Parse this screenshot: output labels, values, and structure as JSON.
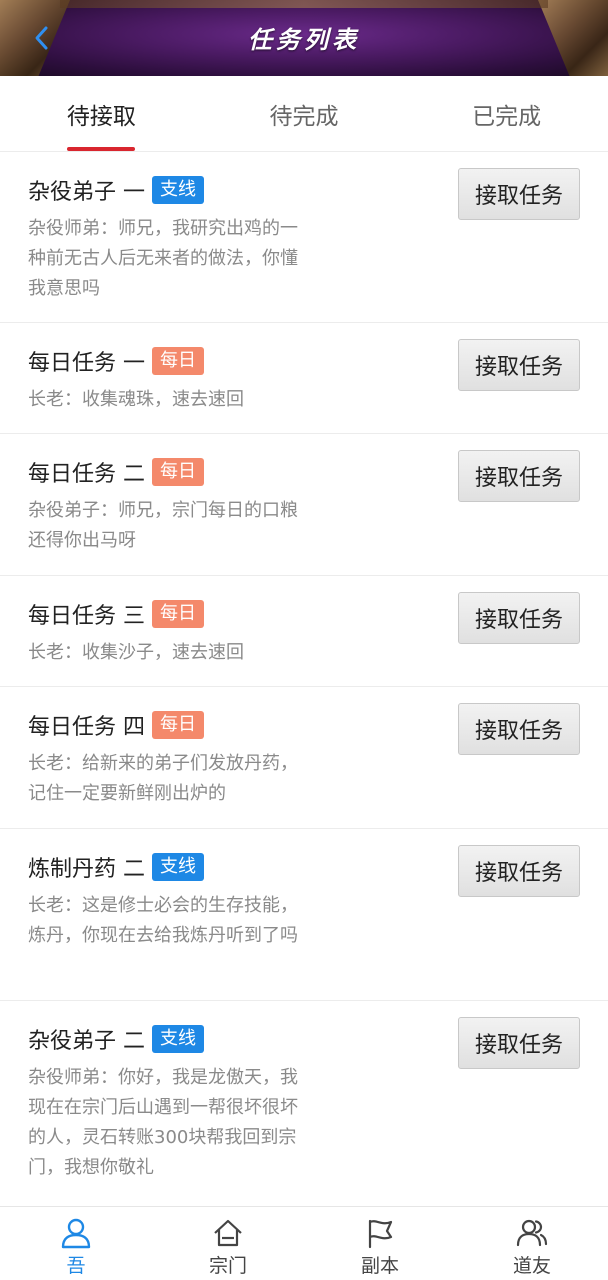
{
  "header": {
    "title": "任务列表"
  },
  "tabs": [
    {
      "label": "待接取",
      "active": true
    },
    {
      "label": "待完成",
      "active": false
    },
    {
      "label": "已完成",
      "active": false
    }
  ],
  "tasks": [
    {
      "title": "杂役弟子 一",
      "badge": "支线",
      "badge_type": "branch",
      "desc": "杂役师弟：师兄，我研究出鸡的一种前无古人后无来者的做法，你懂我意思吗",
      "button": "接取任务"
    },
    {
      "title": "每日任务 一",
      "badge": "每日",
      "badge_type": "daily",
      "desc": "长老：收集魂珠，速去速回",
      "button": "接取任务"
    },
    {
      "title": "每日任务 二",
      "badge": "每日",
      "badge_type": "daily",
      "desc": "杂役弟子：师兄，宗门每日的口粮还得你出马呀",
      "button": "接取任务"
    },
    {
      "title": "每日任务 三",
      "badge": "每日",
      "badge_type": "daily",
      "desc": "长老：收集沙子，速去速回",
      "button": "接取任务"
    },
    {
      "title": "每日任务 四",
      "badge": "每日",
      "badge_type": "daily",
      "desc": "长老：给新来的弟子们发放丹药，记住一定要新鲜刚出炉的",
      "button": "接取任务"
    },
    {
      "title": "炼制丹药 二",
      "badge": "支线",
      "badge_type": "branch",
      "desc": "长老：这是修士必会的生存技能，炼丹，你现在去给我炼丹听到了吗",
      "button": "接取任务"
    },
    {
      "title": "杂役弟子 二",
      "badge": "支线",
      "badge_type": "branch",
      "desc": "杂役师弟：你好，我是龙傲天，我现在在宗门后山遇到一帮很坏很坏的人，灵石转账300块帮我回到宗门，我想你敬礼",
      "button": "接取任务"
    }
  ],
  "bottom_nav": [
    {
      "label": "吾",
      "icon": "person-icon",
      "active": true
    },
    {
      "label": "宗门",
      "icon": "home-icon",
      "active": false
    },
    {
      "label": "副本",
      "icon": "flag-icon",
      "active": false
    },
    {
      "label": "道友",
      "icon": "friends-icon",
      "active": false
    }
  ],
  "colors": {
    "accent": "#1e88e5",
    "tab_underline": "#d9262f",
    "daily_badge": "#f4896b",
    "branch_badge": "#1e88e5"
  }
}
